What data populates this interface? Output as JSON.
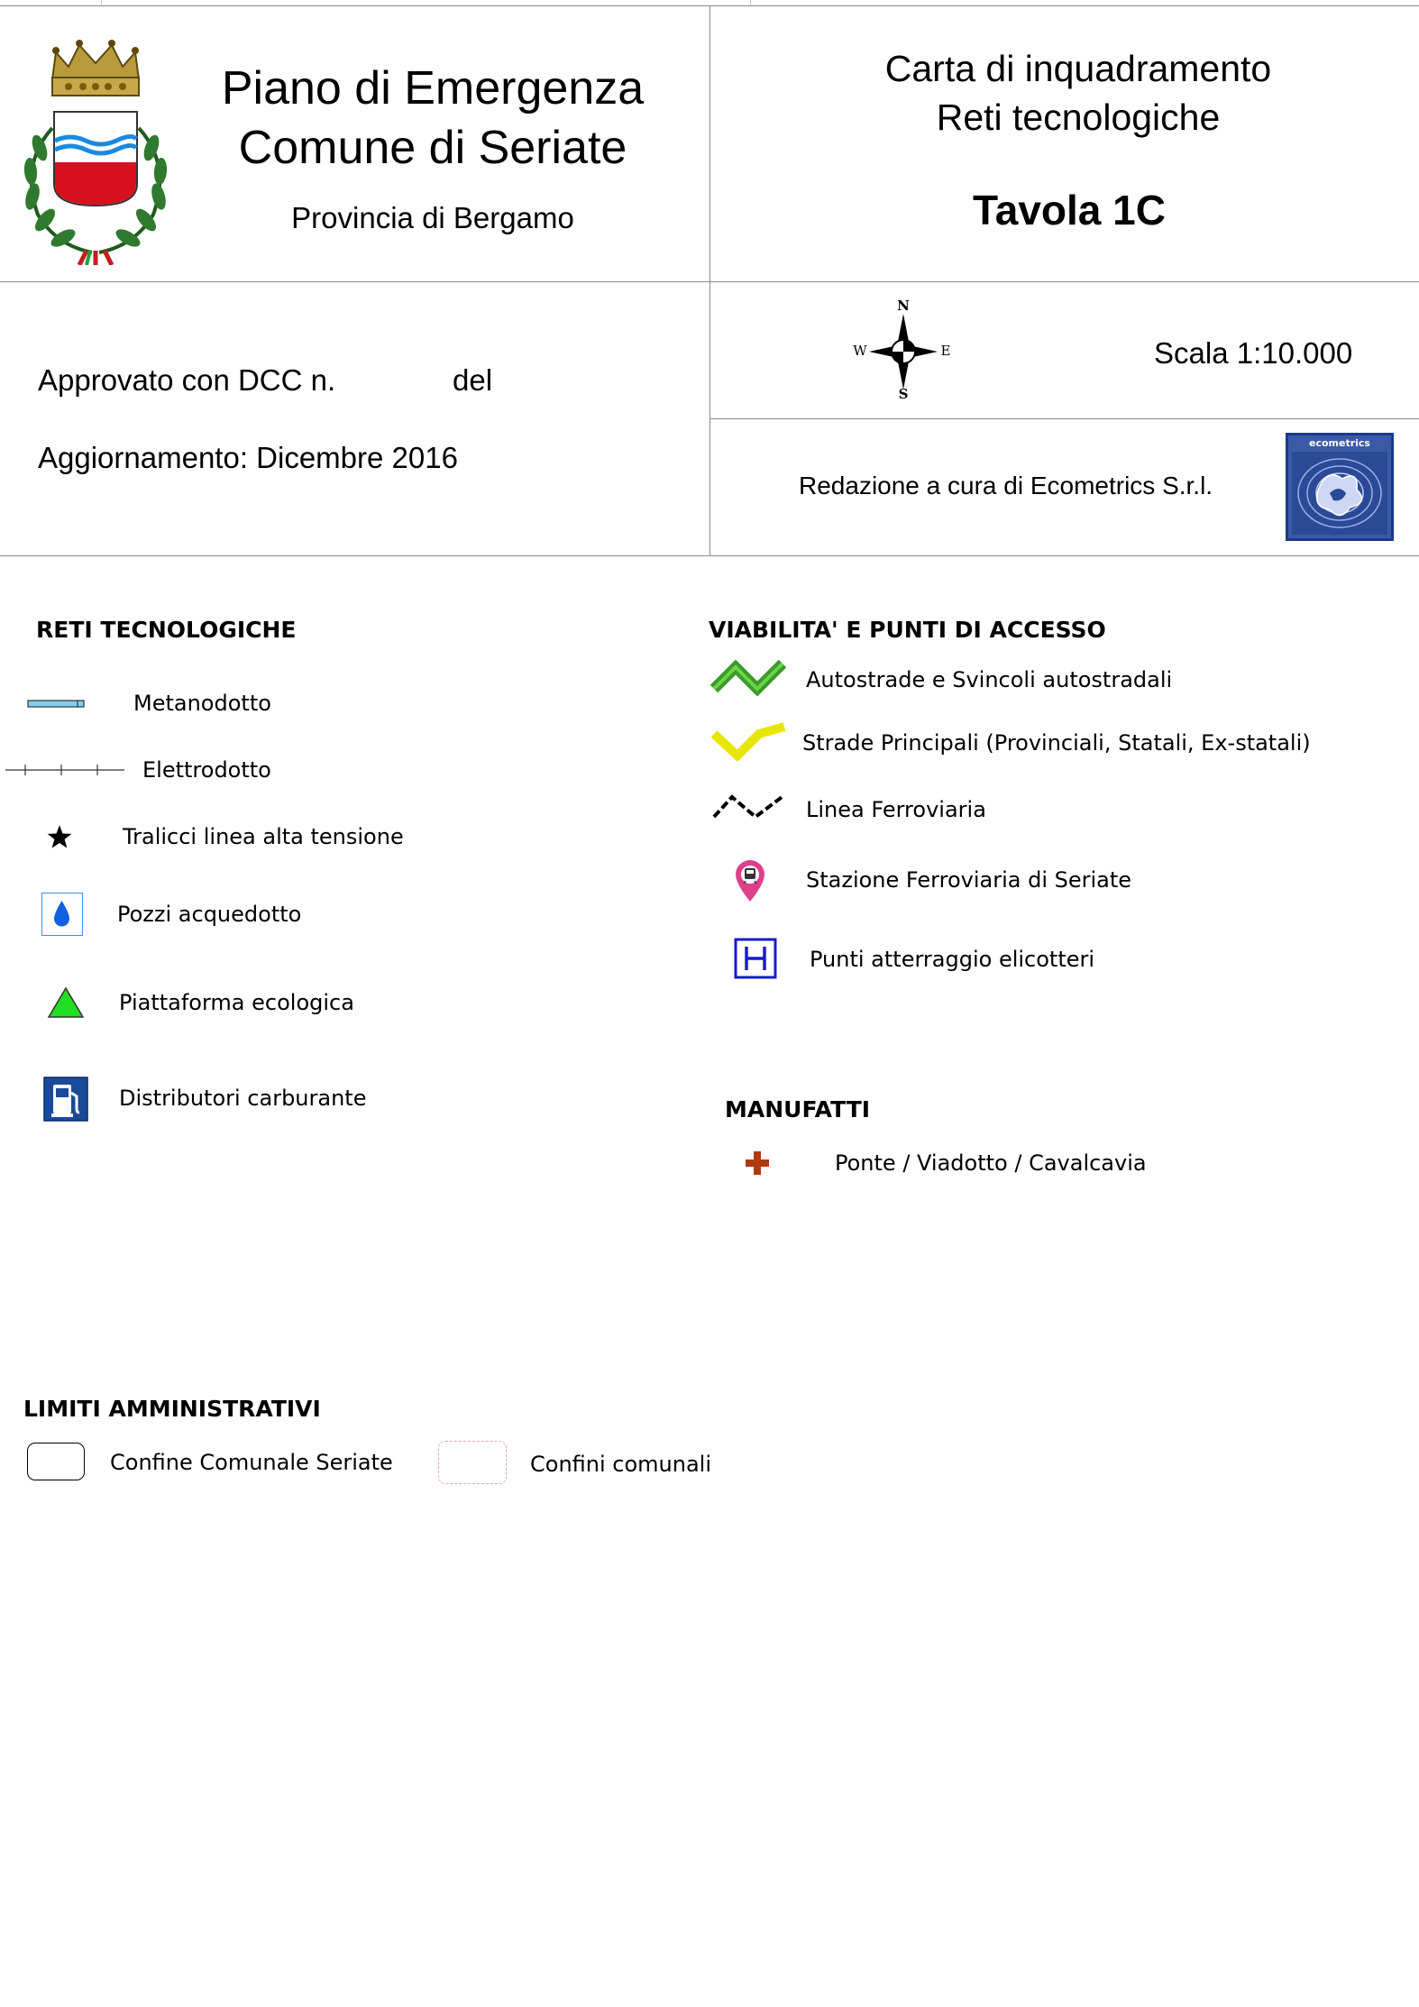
{
  "header": {
    "title_line1": "Piano di Emergenza",
    "title_line2": "Comune di Seriate",
    "province": "Provincia di Bergamo",
    "map_title_line1": "Carta di inquadramento",
    "map_title_line2": "Reti tecnologiche",
    "tavola": "Tavola 1C",
    "approval": "Approvato con DCC n.",
    "approval_del": "del",
    "update": "Aggiornamento: Dicembre 2016",
    "scale": "Scala 1:10.000",
    "editor": "Redazione a cura di Ecometrics S.r.l.",
    "editor_logo_text": "ecometrics",
    "compass": {
      "n": "N",
      "s": "S",
      "e": "E",
      "w": "W"
    }
  },
  "legend": {
    "reti": {
      "title": "RETI TECNOLOGICHE",
      "items": [
        {
          "label": "Metanodotto",
          "icon": "gas-pipeline-line"
        },
        {
          "label": "Elettrodotto",
          "icon": "power-line"
        },
        {
          "label": "Tralicci linea alta tensione",
          "icon": "star-icon"
        },
        {
          "label": "Pozzi acquedotto",
          "icon": "water-drop-icon"
        },
        {
          "label": "Piattaforma ecologica",
          "icon": "green-triangle-icon"
        },
        {
          "label": "Distributori carburante",
          "icon": "fuel-pump-icon"
        }
      ]
    },
    "viabilita": {
      "title": "VIABILITA' E PUNTI DI ACCESSO",
      "items": [
        {
          "label": "Autostrade e Svincoli autostradali",
          "icon": "green-zigzag-line"
        },
        {
          "label": "Strade Principali (Provinciali, Statali, Ex-statali)",
          "icon": "yellow-zigzag-line"
        },
        {
          "label": "Linea Ferroviaria",
          "icon": "railway-dashed-line"
        },
        {
          "label": "Stazione Ferroviaria di Seriate",
          "icon": "train-station-pin-icon"
        },
        {
          "label": "Punti atterraggio elicotteri",
          "icon": "helipad-icon"
        }
      ]
    },
    "manufatti": {
      "title": "MANUFATTI",
      "items": [
        {
          "label": "Ponte / Viadotto / Cavalcavia",
          "icon": "bridge-cross-icon"
        }
      ]
    },
    "limiti": {
      "title": "LIMITI AMMINISTRATIVI",
      "items": [
        {
          "label": "Confine Comunale Seriate",
          "icon": "black-outline-box"
        },
        {
          "label": "Confini comunali",
          "icon": "pink-dashed-box"
        }
      ]
    }
  },
  "colors": {
    "frame_lines": "#8a8a8a",
    "gas_line": "#7fd0f0",
    "motorway": "#3a9a2a",
    "main_road": "#e6e600",
    "water": "#1060e0",
    "eco_triangle": "#22dd22",
    "fuel": "#1a4a9a",
    "helipad": "#1a1ad0",
    "bridge": "#b03a10",
    "station_pin": "#e0408a",
    "comune_boundary_pink": "#f0a0b8"
  }
}
